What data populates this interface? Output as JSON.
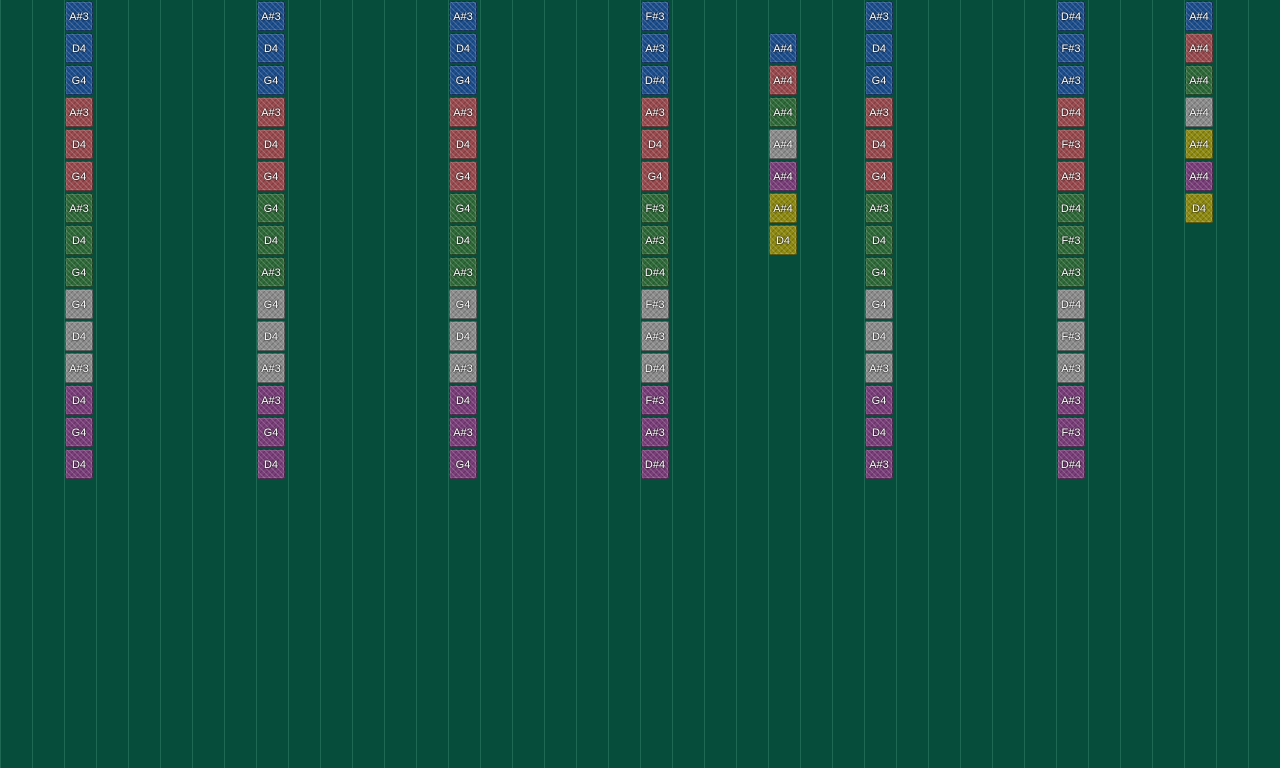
{
  "colors": {
    "background": "#074D3C",
    "grid_line": "#2E7A63",
    "blue": "#1C4E8E",
    "red": "#9A4A4E",
    "green": "#2E6A38",
    "gray": "#8C8C8C",
    "purple": "#7A3E7A",
    "yellow": "#8E8A10"
  },
  "columns": [
    {
      "name": "column-1",
      "notes": [
        {
          "label": "A#3",
          "color": "blue"
        },
        {
          "label": "D4",
          "color": "blue"
        },
        {
          "label": "G4",
          "color": "blue"
        },
        {
          "label": "A#3",
          "color": "red"
        },
        {
          "label": "D4",
          "color": "red"
        },
        {
          "label": "G4",
          "color": "red"
        },
        {
          "label": "A#3",
          "color": "green"
        },
        {
          "label": "D4",
          "color": "green"
        },
        {
          "label": "G4",
          "color": "green"
        },
        {
          "label": "G4",
          "color": "gray"
        },
        {
          "label": "D4",
          "color": "gray"
        },
        {
          "label": "A#3",
          "color": "gray"
        },
        {
          "label": "D4",
          "color": "purple"
        },
        {
          "label": "G4",
          "color": "purple"
        },
        {
          "label": "D4",
          "color": "purple"
        }
      ]
    },
    {
      "name": "column-2",
      "notes": [
        {
          "label": "A#3",
          "color": "blue"
        },
        {
          "label": "D4",
          "color": "blue"
        },
        {
          "label": "G4",
          "color": "blue"
        },
        {
          "label": "A#3",
          "color": "red"
        },
        {
          "label": "D4",
          "color": "red"
        },
        {
          "label": "G4",
          "color": "red"
        },
        {
          "label": "G4",
          "color": "green"
        },
        {
          "label": "D4",
          "color": "green"
        },
        {
          "label": "A#3",
          "color": "green"
        },
        {
          "label": "G4",
          "color": "gray"
        },
        {
          "label": "D4",
          "color": "gray"
        },
        {
          "label": "A#3",
          "color": "gray"
        },
        {
          "label": "A#3",
          "color": "purple"
        },
        {
          "label": "G4",
          "color": "purple"
        },
        {
          "label": "D4",
          "color": "purple"
        }
      ]
    },
    {
      "name": "column-3",
      "notes": [
        {
          "label": "A#3",
          "color": "blue"
        },
        {
          "label": "D4",
          "color": "blue"
        },
        {
          "label": "G4",
          "color": "blue"
        },
        {
          "label": "A#3",
          "color": "red"
        },
        {
          "label": "D4",
          "color": "red"
        },
        {
          "label": "G4",
          "color": "red"
        },
        {
          "label": "G4",
          "color": "green"
        },
        {
          "label": "D4",
          "color": "green"
        },
        {
          "label": "A#3",
          "color": "green"
        },
        {
          "label": "G4",
          "color": "gray"
        },
        {
          "label": "D4",
          "color": "gray"
        },
        {
          "label": "A#3",
          "color": "gray"
        },
        {
          "label": "D4",
          "color": "purple"
        },
        {
          "label": "A#3",
          "color": "purple"
        },
        {
          "label": "G4",
          "color": "purple"
        }
      ]
    },
    {
      "name": "column-4",
      "notes": [
        {
          "label": "F#3",
          "color": "blue"
        },
        {
          "label": "A#3",
          "color": "blue"
        },
        {
          "label": "D#4",
          "color": "blue"
        },
        {
          "label": "A#3",
          "color": "red"
        },
        {
          "label": "D4",
          "color": "red"
        },
        {
          "label": "G4",
          "color": "red"
        },
        {
          "label": "F#3",
          "color": "green"
        },
        {
          "label": "A#3",
          "color": "green"
        },
        {
          "label": "D#4",
          "color": "green"
        },
        {
          "label": "F#3",
          "color": "gray"
        },
        {
          "label": "A#3",
          "color": "gray"
        },
        {
          "label": "D#4",
          "color": "gray"
        },
        {
          "label": "F#3",
          "color": "purple"
        },
        {
          "label": "A#3",
          "color": "purple"
        },
        {
          "label": "D#4",
          "color": "purple"
        }
      ]
    },
    {
      "name": "column-5",
      "notes": [
        {
          "label": "A#4",
          "color": "blue"
        },
        {
          "label": "A#4",
          "color": "red"
        },
        {
          "label": "A#4",
          "color": "green"
        },
        {
          "label": "A#4",
          "color": "gray"
        },
        {
          "label": "A#4",
          "color": "purple"
        },
        {
          "label": "A#4",
          "color": "yellow"
        },
        {
          "label": "D4",
          "color": "yellow"
        }
      ]
    },
    {
      "name": "column-6",
      "notes": [
        {
          "label": "A#3",
          "color": "blue"
        },
        {
          "label": "D4",
          "color": "blue"
        },
        {
          "label": "G4",
          "color": "blue"
        },
        {
          "label": "A#3",
          "color": "red"
        },
        {
          "label": "D4",
          "color": "red"
        },
        {
          "label": "G4",
          "color": "red"
        },
        {
          "label": "A#3",
          "color": "green"
        },
        {
          "label": "D4",
          "color": "green"
        },
        {
          "label": "G4",
          "color": "green"
        },
        {
          "label": "G4",
          "color": "gray"
        },
        {
          "label": "D4",
          "color": "gray"
        },
        {
          "label": "A#3",
          "color": "gray"
        },
        {
          "label": "G4",
          "color": "purple"
        },
        {
          "label": "D4",
          "color": "purple"
        },
        {
          "label": "A#3",
          "color": "purple"
        }
      ]
    },
    {
      "name": "column-7",
      "notes": [
        {
          "label": "D#4",
          "color": "blue"
        },
        {
          "label": "F#3",
          "color": "blue"
        },
        {
          "label": "A#3",
          "color": "blue"
        },
        {
          "label": "D#4",
          "color": "red"
        },
        {
          "label": "F#3",
          "color": "red"
        },
        {
          "label": "A#3",
          "color": "red"
        },
        {
          "label": "D#4",
          "color": "green"
        },
        {
          "label": "F#3",
          "color": "green"
        },
        {
          "label": "A#3",
          "color": "green"
        },
        {
          "label": "D#4",
          "color": "gray"
        },
        {
          "label": "F#3",
          "color": "gray"
        },
        {
          "label": "A#3",
          "color": "gray"
        },
        {
          "label": "A#3",
          "color": "purple"
        },
        {
          "label": "F#3",
          "color": "purple"
        },
        {
          "label": "D#4",
          "color": "purple"
        }
      ]
    },
    {
      "name": "column-8",
      "notes": [
        {
          "label": "A#4",
          "color": "blue"
        },
        {
          "label": "A#4",
          "color": "red"
        },
        {
          "label": "A#4",
          "color": "green"
        },
        {
          "label": "A#4",
          "color": "gray"
        },
        {
          "label": "A#4",
          "color": "yellow"
        },
        {
          "label": "A#4",
          "color": "purple"
        },
        {
          "label": "D4",
          "color": "yellow"
        }
      ]
    }
  ]
}
